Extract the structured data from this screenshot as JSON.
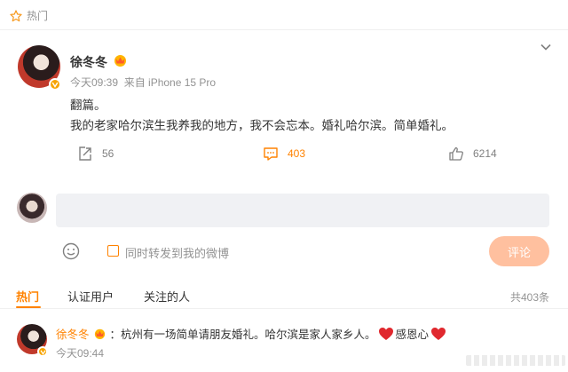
{
  "header": {
    "section_label": "热门"
  },
  "post": {
    "author": "徐冬冬",
    "timestamp": "今天09:39",
    "source": "来自 iPhone 15 Pro",
    "lines": [
      "翻篇。",
      "我的老家哈尔滨生我养我的地方，我不会忘本。婚礼哈尔滨。简单婚礼。"
    ],
    "actions": {
      "repost_count": "56",
      "comment_count": "403",
      "like_count": "6214"
    }
  },
  "composer": {
    "sync_label": "同时转发到我的微博",
    "submit_label": "评论"
  },
  "tabs": {
    "items": [
      "热门",
      "认证用户",
      "关注的人"
    ],
    "total": "共403条"
  },
  "comment": {
    "author": "徐冬冬",
    "separator": "：",
    "text_before": "杭州有一场简单请朋友婚礼。哈尔滨是家人家乡人。",
    "text_after": "感恩心",
    "timestamp": "今天09:44"
  },
  "colors": {
    "accent": "#ff8200",
    "muted": "#939393",
    "badge": "#f7a400",
    "heart": "#e0282e"
  }
}
